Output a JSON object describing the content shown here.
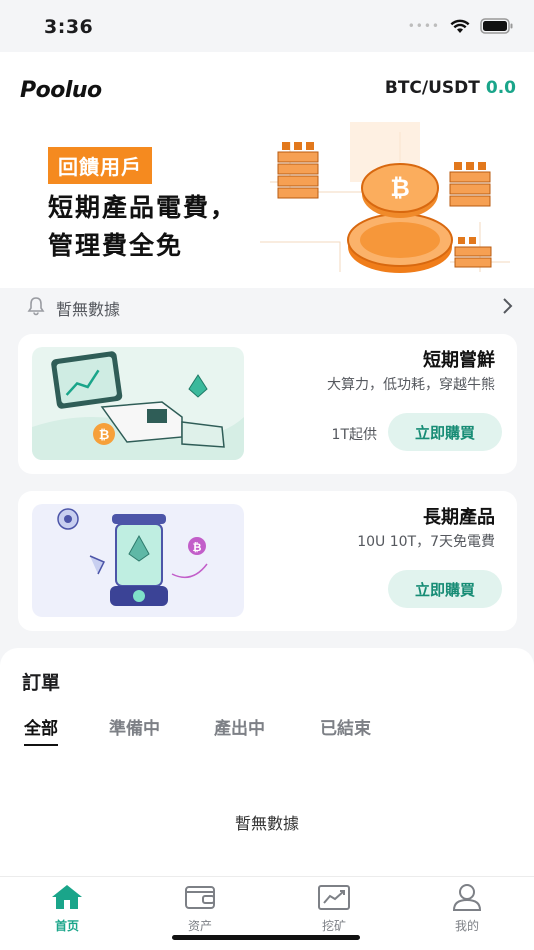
{
  "status_bar": {
    "time": "3:36"
  },
  "header": {
    "logo": "Pooluo",
    "pair": "BTC/USDT",
    "price": "0.0"
  },
  "banner": {
    "tag": "回饋用戶",
    "line1": "短期產品電費，",
    "line2": "管理費全免"
  },
  "notice": {
    "text": "暫無數據"
  },
  "products": [
    {
      "title": "短期嘗鮮",
      "desc": "大算力，低功耗，穿越牛熊",
      "min": "1T起供",
      "button": "立即購買"
    },
    {
      "title": "長期產品",
      "desc": "10U 10T，7天免電費",
      "min": "",
      "button": "立即購買"
    }
  ],
  "orders": {
    "title": "訂單",
    "tabs": [
      "全部",
      "準備中",
      "產出中",
      "已結束"
    ],
    "empty": "暫無數據"
  },
  "tabbar": [
    {
      "label": "首页",
      "icon": "home-icon"
    },
    {
      "label": "资产",
      "icon": "wallet-icon"
    },
    {
      "label": "挖矿",
      "icon": "chart-icon"
    },
    {
      "label": "我的",
      "icon": "user-icon"
    }
  ],
  "colors": {
    "accent": "#1aa58a",
    "orange": "#f58a1f",
    "button_bg": "#e1f3ee"
  }
}
